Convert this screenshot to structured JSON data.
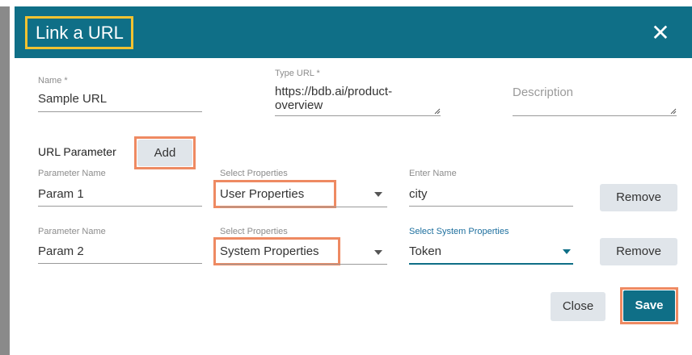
{
  "dialog": {
    "title": "Link a URL"
  },
  "form": {
    "name_label": "Name *",
    "name_value": "Sample URL",
    "type_url_label": "Type URL *",
    "type_url_value_line1": "https://bdb.ai/product-",
    "type_url_value_line2": "overview",
    "description_placeholder": "Description"
  },
  "url_parameter": {
    "section_label": "URL Parameter",
    "add_label": "Add"
  },
  "params": [
    {
      "name_label": "Parameter Name",
      "name_value": "Param 1",
      "props_label": "Select Properties",
      "props_value": "User Properties",
      "third_label": "Enter Name",
      "third_value": "city",
      "remove_label": "Remove"
    },
    {
      "name_label": "Parameter Name",
      "name_value": "Param 2",
      "props_label": "Select Properties",
      "props_value": "System Properties",
      "third_label": "Select System Properties",
      "third_value": "Token",
      "remove_label": "Remove"
    }
  ],
  "footer": {
    "close_label": "Close",
    "save_label": "Save"
  },
  "colors": {
    "header": "#0f6f87",
    "title_highlight": "#f2c230",
    "annotation_highlight": "#ee8a62"
  },
  "icons": {
    "close": "close-icon",
    "dropdown": "chevron-down-icon",
    "resize": "resize-handle-icon"
  }
}
